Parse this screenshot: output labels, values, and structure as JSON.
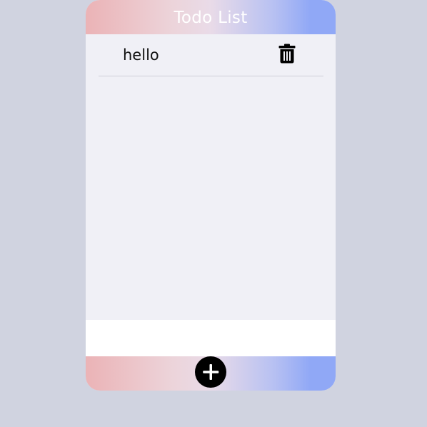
{
  "header": {
    "title": "Todo List"
  },
  "todos": [
    {
      "text": "hello",
      "delete_icon": "trash-icon"
    }
  ],
  "input": {
    "value": "",
    "placeholder": ""
  },
  "footer": {
    "add_icon": "plus-icon"
  },
  "colors": {
    "background": "#d0d3e0",
    "gradient_start": "#ebb3b6",
    "gradient_end": "#90a8f6",
    "list_bg": "#f0f0f6",
    "button": "#000000"
  }
}
